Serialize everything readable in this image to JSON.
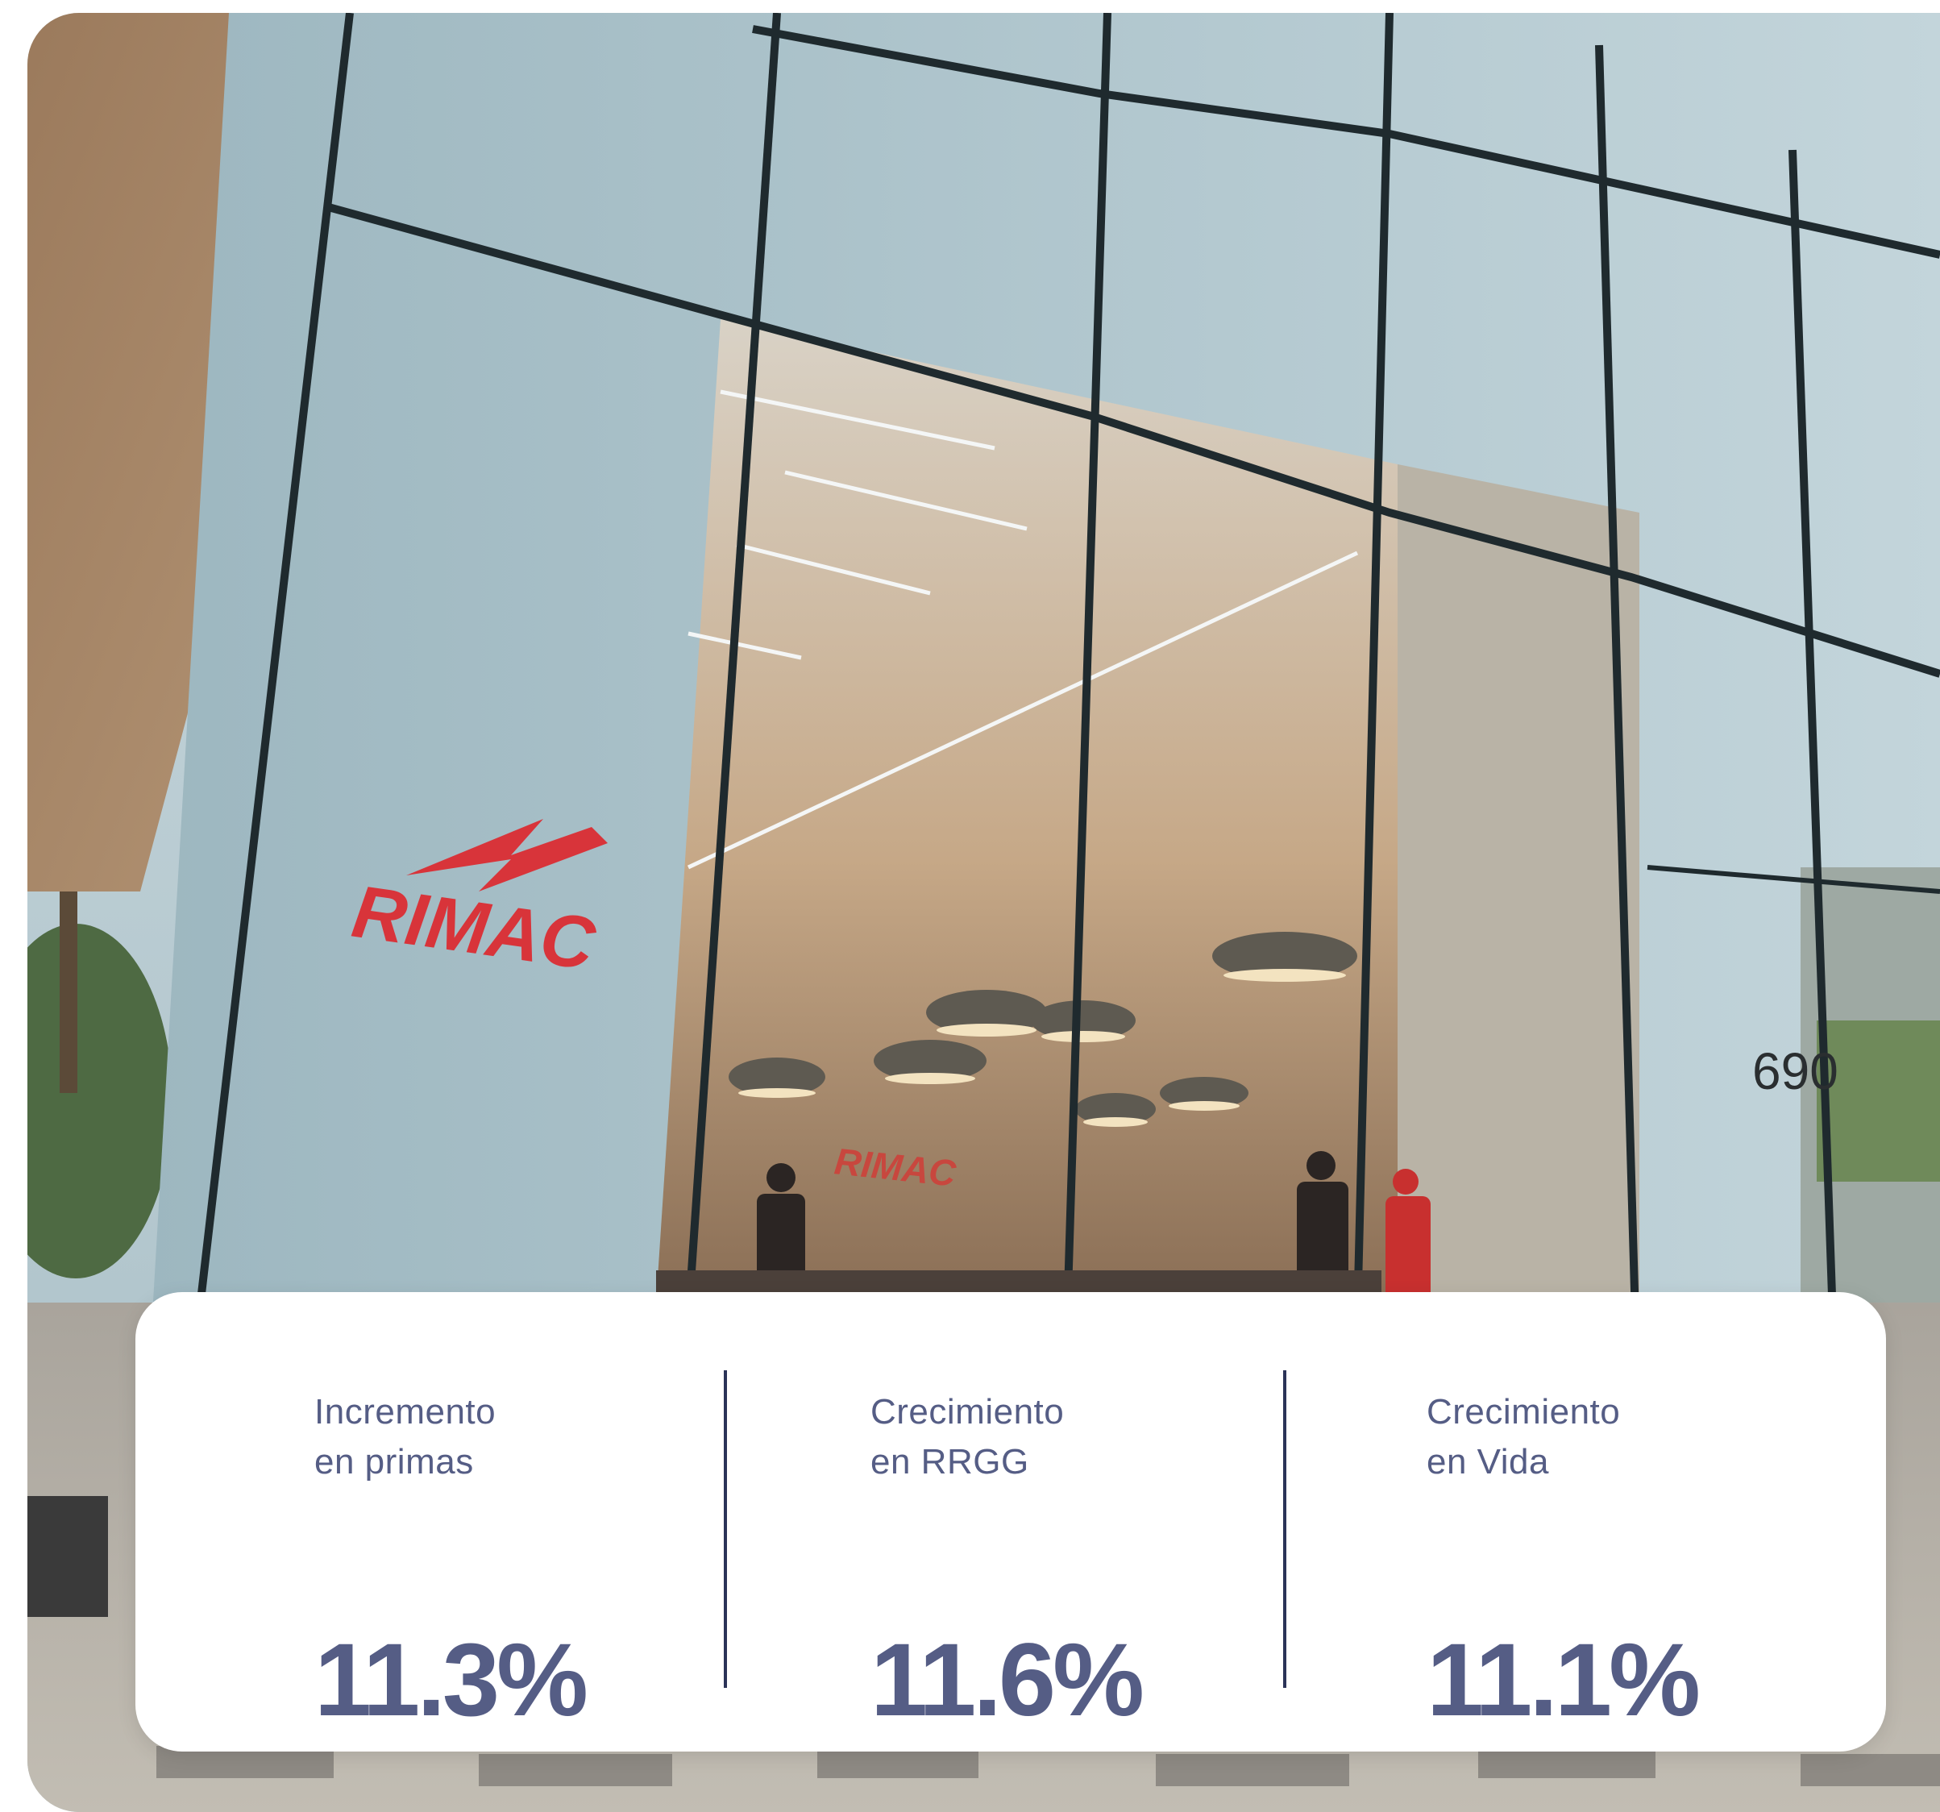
{
  "photo": {
    "sign_text": "RIMAC",
    "interior_sign_text": "RIMAC",
    "building_number": "690"
  },
  "stats": [
    {
      "label": "Incremento\nen primas",
      "value": "11.3%"
    },
    {
      "label": "Crecimiento\nen RRGG",
      "value": "11.6%"
    },
    {
      "label": "Crecimiento\nen Vida",
      "value": "11.1%"
    }
  ],
  "colors": {
    "stat_text": "#555d85",
    "divider": "#2b3358",
    "brand_red": "#d8343a"
  }
}
